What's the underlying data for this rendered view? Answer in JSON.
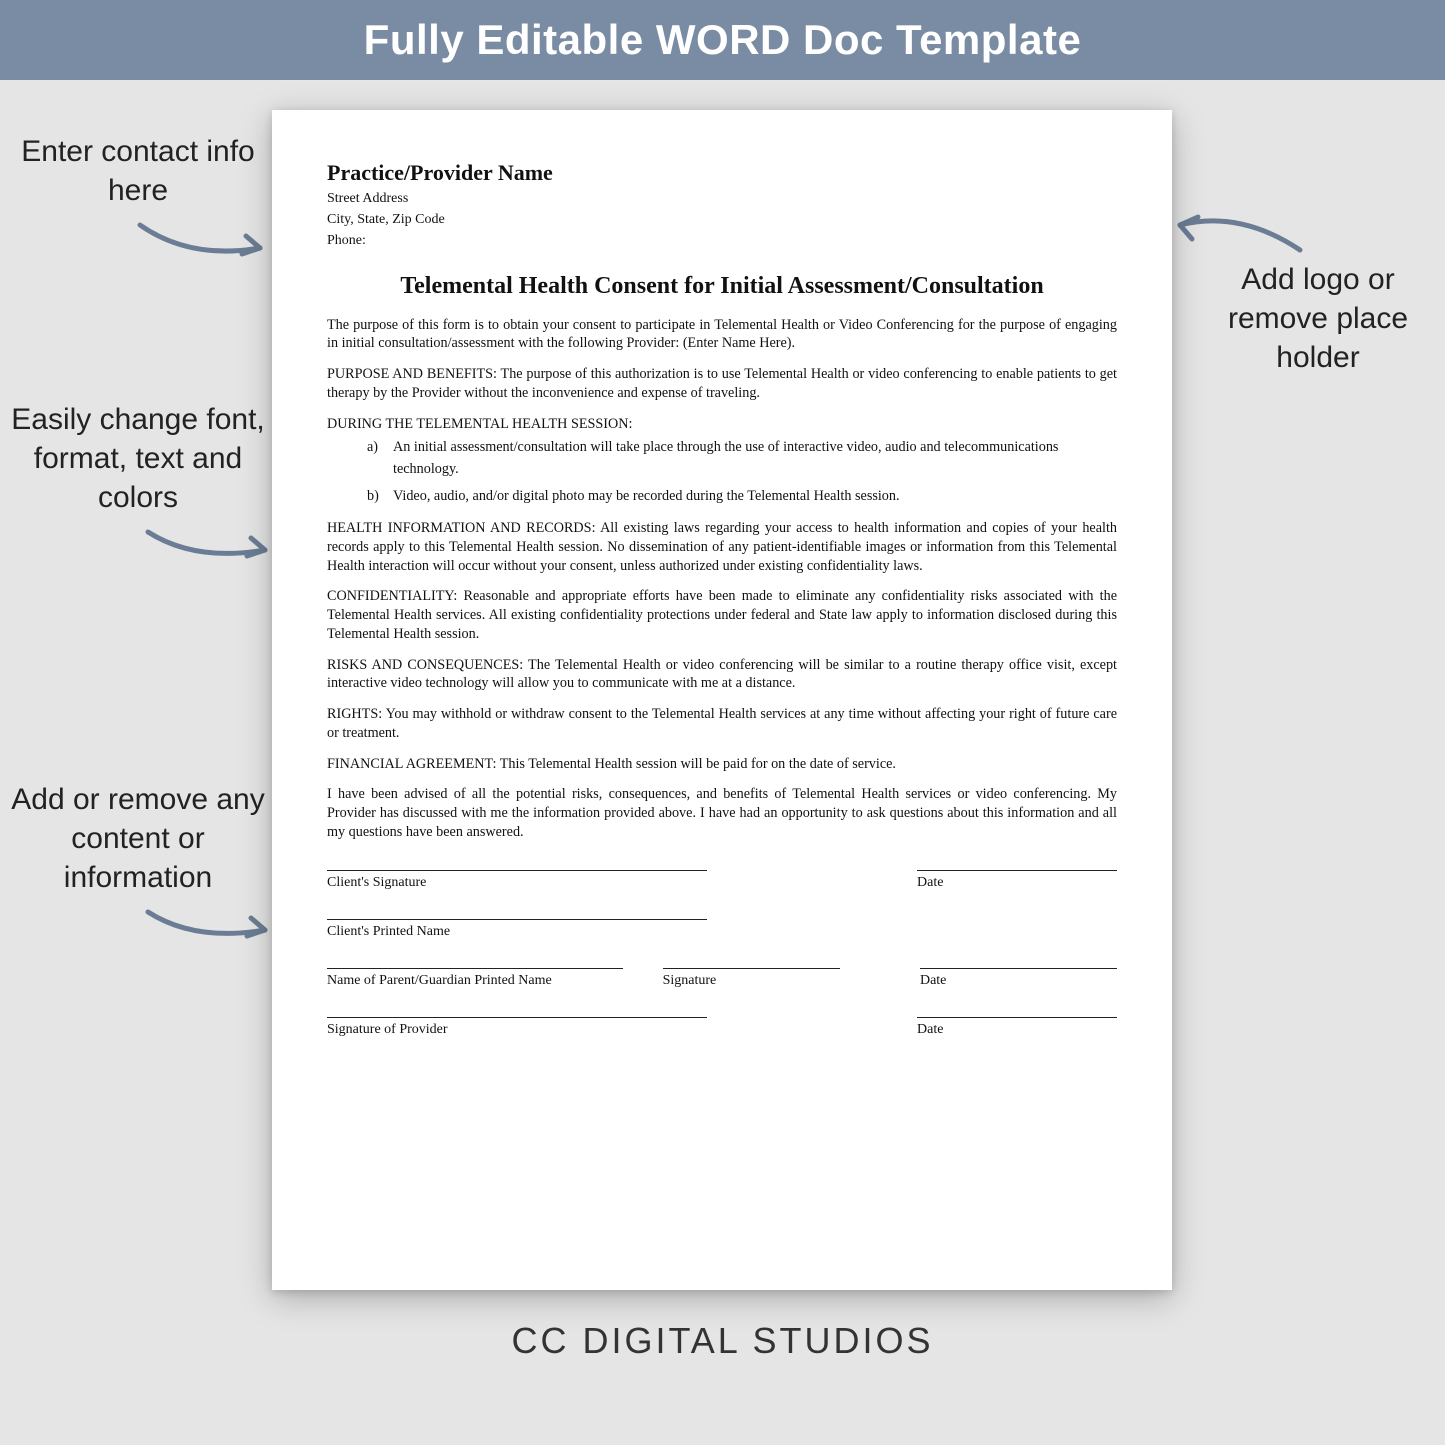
{
  "header": {
    "title": "Fully Editable WORD Doc Template"
  },
  "callouts": {
    "c1": "Enter contact info here",
    "c2": "Easily change font, format, text and colors",
    "c3": "Add or remove any content or information",
    "c4": "Add logo or remove place holder"
  },
  "doc": {
    "providerName": "Practice/Provider Name",
    "addr1": "Street Address",
    "addr2": "City, State, Zip Code",
    "addr3": "Phone:",
    "title": "Telemental Health Consent for Initial Assessment/Consultation",
    "intro": "The purpose of this form is to obtain your consent to participate in Telemental Health or Video Conferencing for the purpose of engaging in initial consultation/assessment with the following Provider: (Enter Name Here).",
    "purpose": "PURPOSE AND BENEFITS:  The purpose of this authorization is to use Telemental Health or video conferencing to enable patients to get therapy by the Provider without the inconvenience and expense of traveling.",
    "duringHeading": "DURING THE TELEMENTAL HEALTH SESSION:",
    "during": [
      {
        "marker": "a)",
        "text": "An initial assessment/consultation will take place through the use of interactive video, audio and telecommunications technology."
      },
      {
        "marker": "b)",
        "text": "Video, audio, and/or digital photo may be recorded during the Telemental Health session."
      }
    ],
    "healthInfo": "HEALTH INFORMATION AND RECORDS:  All existing laws regarding your access to health information and copies of your health records apply to this Telemental Health session.  No dissemination of any patient-identifiable images or information from this Telemental Health interaction will occur without your consent, unless authorized under existing confidentiality laws.",
    "confidentiality": "CONFIDENTIALITY:  Reasonable and appropriate efforts have been made to eliminate any confidentiality risks associated with the Telemental Health services. All existing confidentiality protections under federal and State law apply to information disclosed during this Telemental Health session.",
    "risks": "RISKS AND CONSEQUENCES: The Telemental Health or video conferencing will be similar to a routine therapy office visit, except interactive video technology will allow you to communicate with me at a distance.",
    "rights": "RIGHTS:  You may withhold or withdraw consent to the Telemental Health services at any time without affecting your right of future care or treatment.",
    "financial": "FINANCIAL AGREEMENT:  This Telemental Health session will be paid for on the date of service.",
    "ack": "I have been advised of all the potential risks, consequences, and benefits of Telemental Health services or video conferencing.  My Provider has discussed with me the information provided above.  I have had an opportunity to ask questions about this information and all my questions have been answered.",
    "sig": {
      "clientSig": "Client's Signature",
      "date": "Date",
      "clientPrinted": "Client's Printed Name",
      "parentPrinted": "Name of Parent/Guardian Printed Name",
      "signature": "Signature",
      "providerSig": "Signature of Provider"
    }
  },
  "footer": {
    "brand": "CC DIGITAL STUDIOS"
  },
  "colors": {
    "accent": "#7a8ca3",
    "arrow": "#6b7d94"
  }
}
